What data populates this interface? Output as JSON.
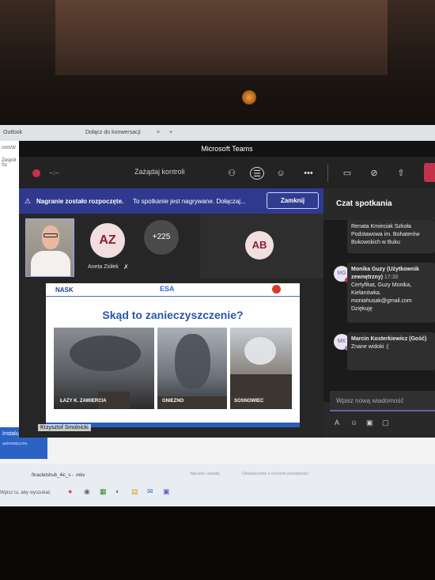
{
  "window": {
    "title": "Microsoft Teams"
  },
  "browser": {
    "tab1": "Outlook",
    "tab2": "Dołącz do konwersacji",
    "tab_close": "×",
    "new_tab": "+",
    "left_items": [
      "com/d/",
      "Zespół Sz"
    ],
    "install_title": "Instaluj aplikację",
    "install_sub": "automatyczne."
  },
  "taskbar": {
    "file_item": "finacletshub_4ic_s - .mkv",
    "search_text": "Wpisz tu, aby wyszukać",
    "footer1": "Warunki i zasady",
    "footer2": "Oświadczenie o ochronie prywatności"
  },
  "toolbar": {
    "timer": "--:--",
    "request_control": "Zażądaj kontroli",
    "icons": [
      "people-icon",
      "chat-icon",
      "reactions-icon",
      "more-icon",
      "camera-off-icon",
      "mic-off-icon",
      "share-icon"
    ]
  },
  "banner": {
    "warning_icon": "⚠",
    "title": "Nagranie zostało rozpoczęte.",
    "text": "To spotkanie jest nagrywane. Dołączaj...",
    "close_label": "Zamknij"
  },
  "participants": {
    "az_initials": "AZ",
    "az_name": "Aneta Ziółek",
    "more_count": "+225",
    "ab_initials": "AB",
    "presenter_name": "Krzysztof Smolnicki"
  },
  "slide": {
    "logo_left": "NASK",
    "logo_center": "ESA",
    "title": "Skąd to zanieczyszczenie?",
    "photos": [
      {
        "label": "ŁAZY K. ZAWIERCIA"
      },
      {
        "label": "GNIEZNO"
      },
      {
        "label": "SOSNOWIEC"
      }
    ]
  },
  "chat": {
    "title": "Czat spotkania",
    "messages": [
      {
        "text": "Renata Kmieciak Szkoła Podstawowa im. Bohaterów Bukowskich w Buku"
      },
      {
        "initials": "MG",
        "author": "Monika Guzy (Użytkownik zewnętrzny)",
        "time": "17:30",
        "text": "Certyfikat, Guzy Monika, Kielanówka. moniahusak@gmail.com Dziękuję"
      },
      {
        "initials": "MK",
        "author": "Marcin Kosterkiewicz (Gość)",
        "text": "Znane widoki :("
      }
    ],
    "compose_placeholder": "Wpisz nową wiadomość"
  },
  "colors": {
    "brand": "#6264a7",
    "banner": "#2f3a8e",
    "record": "#c4314b",
    "slide_title": "#2a55a8"
  }
}
